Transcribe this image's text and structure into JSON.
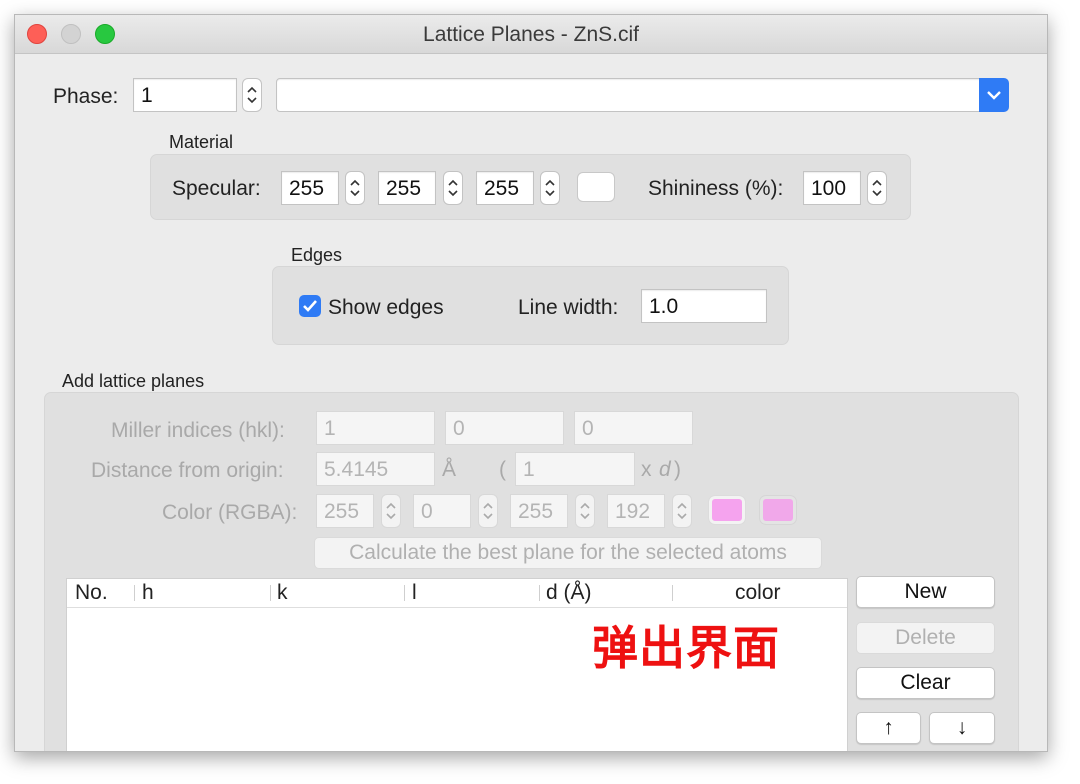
{
  "window": {
    "title": "Lattice Planes - ZnS.cif"
  },
  "phase": {
    "label": "Phase:",
    "value": "1",
    "dropdown_value": ""
  },
  "material": {
    "heading": "Material",
    "specular_label": "Specular:",
    "specular_r": "255",
    "specular_g": "255",
    "specular_b": "255",
    "shininess_label": "Shininess (%):",
    "shininess_value": "100"
  },
  "edges": {
    "heading": "Edges",
    "show_edges_label": "Show edges",
    "show_edges_checked": true,
    "line_width_label": "Line width:",
    "line_width_value": "1.0"
  },
  "add_planes": {
    "heading": "Add lattice planes",
    "miller_label": "Miller indices (hkl):",
    "h": "1",
    "k": "0",
    "l": "0",
    "distance_label": "Distance from origin:",
    "distance_value": "5.4145",
    "distance_unit": "Å",
    "paren_open": "(",
    "multiplier_value": "1",
    "multiplier_suffix_x": "x",
    "multiplier_suffix_d": "d",
    "paren_close": ")",
    "color_label": "Color (RGBA):",
    "r": "255",
    "g": "0",
    "b": "255",
    "a": "192",
    "calc_button": "Calculate the best plane for the selected atoms"
  },
  "table": {
    "columns": [
      "No.",
      "h",
      "k",
      "l",
      "d (Å)",
      "color"
    ],
    "rows": []
  },
  "buttons": {
    "new": "New",
    "delete": "Delete",
    "clear": "Clear",
    "up": "↑",
    "down": "↓"
  },
  "overlay": {
    "caption": "弹出界面"
  },
  "colors": {
    "accent": "#2f7bf5",
    "plane_swatch": "#f5a3ee",
    "overlay_text": "#ee1111",
    "close": "#fe5f57",
    "minimize": "#d0d0d0",
    "zoom": "#28c840"
  }
}
